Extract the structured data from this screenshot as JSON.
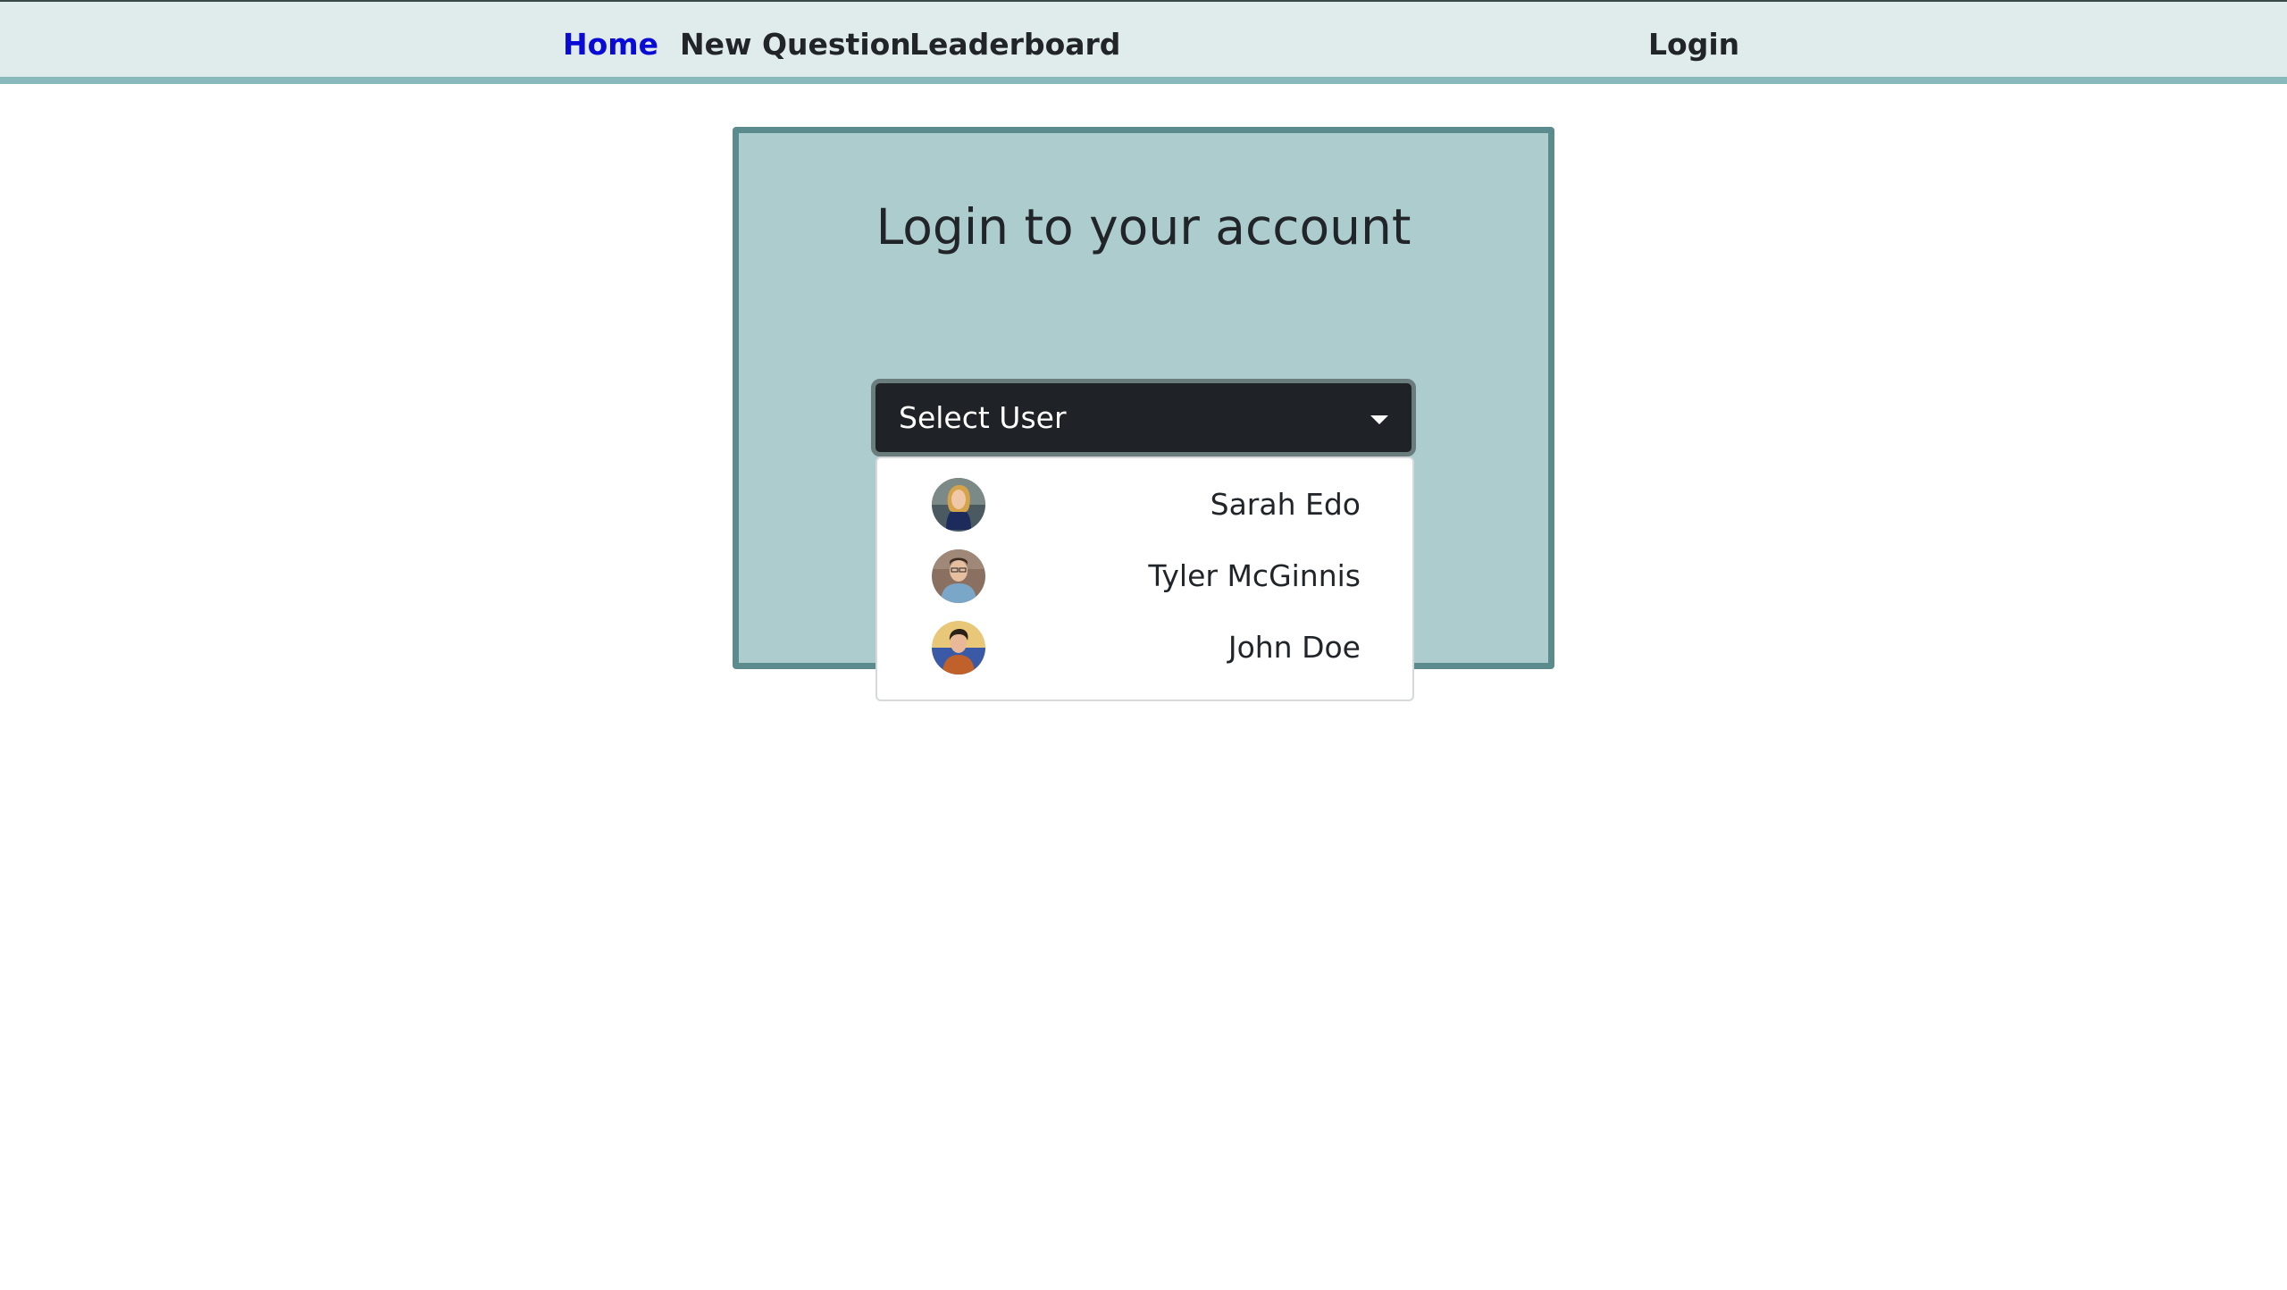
{
  "nav": {
    "home": "Home",
    "new_question": "New Question",
    "leaderboard": "Leaderboard",
    "login": "Login",
    "active_color": "#0a0ad6"
  },
  "login_card": {
    "title": "Login to your account"
  },
  "select": {
    "label": "Select User",
    "icon": "caret-down-icon"
  },
  "users": [
    {
      "name": "Sarah Edo",
      "avatar": "avatar-sarah-edo"
    },
    {
      "name": "Tyler McGinnis",
      "avatar": "avatar-tyler-mcginnis"
    },
    {
      "name": "John Doe",
      "avatar": "avatar-john-doe"
    }
  ],
  "colors": {
    "navbar_bg": "#e0ecec",
    "card_bg": "#adcccd",
    "card_border": "#5c8b8d",
    "select_bg": "#1f2226"
  }
}
